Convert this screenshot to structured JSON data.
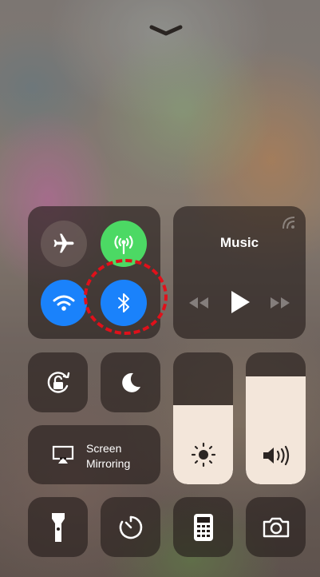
{
  "control_center": {
    "grabber": "chevron-down-icon",
    "connectivity": {
      "airplane": {
        "icon": "airplane-icon",
        "active": false
      },
      "cellular": {
        "icon": "cellular-antenna-icon",
        "active": true,
        "color": "#4cd964"
      },
      "wifi": {
        "icon": "wifi-icon",
        "active": true,
        "color": "#1a82fb"
      },
      "bluetooth": {
        "icon": "bluetooth-icon",
        "active": true,
        "color": "#1a82fb"
      }
    },
    "music": {
      "title": "Music",
      "controls": [
        "rewind-icon",
        "play-icon",
        "fast-forward-icon"
      ]
    },
    "orientation_lock": {
      "icon": "rotation-lock-icon"
    },
    "do_not_disturb": {
      "icon": "moon-icon"
    },
    "screen_mirroring": {
      "line1": "Screen",
      "line2": "Mirroring",
      "icon": "airplay-icon"
    },
    "brightness": {
      "icon": "sun-icon",
      "level": 0.6
    },
    "volume": {
      "icon": "speaker-icon",
      "level": 0.82
    },
    "shortcuts": [
      "flashlight-icon",
      "timer-icon",
      "calculator-icon",
      "camera-icon"
    ],
    "annotation": {
      "color": "#e0101a",
      "target": "bluetooth"
    }
  }
}
